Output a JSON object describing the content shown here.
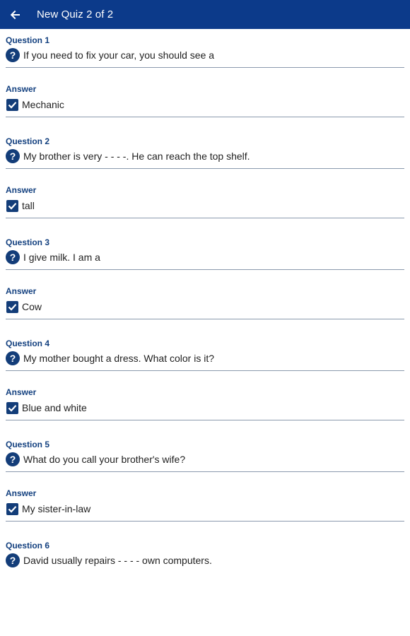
{
  "appbar": {
    "title": "New Quiz 2 of 2"
  },
  "items": [
    {
      "question_label": "Question 1",
      "question": "If you need to fix your car, you should see a",
      "answer_label": "Answer",
      "answer": "Mechanic"
    },
    {
      "question_label": "Question 2",
      "question": "My brother is very - - - -. He can reach the top shelf.",
      "answer_label": "Answer",
      "answer": "tall"
    },
    {
      "question_label": "Question 3",
      "question": "I give milk. I am a",
      "answer_label": "Answer",
      "answer": "Cow"
    },
    {
      "question_label": "Question 4",
      "question": "My mother bought a dress. What color is it?",
      "answer_label": "Answer",
      "answer": "Blue and white"
    },
    {
      "question_label": "Question 5",
      "question": "What do you call your brother's wife?",
      "answer_label": "Answer",
      "answer": "My sister-in-law"
    },
    {
      "question_label": "Question 6",
      "question": "David usually repairs - - - - own computers.",
      "answer_label": "",
      "answer": ""
    }
  ],
  "icons": {
    "back": "arrow-left-icon",
    "question": "question-circle-icon",
    "answer": "checkbox-checked-icon"
  },
  "colors": {
    "appbar": "#0c3a8a",
    "label": "#13407f",
    "icon": "#133d79",
    "divider": "#8a99ad"
  }
}
